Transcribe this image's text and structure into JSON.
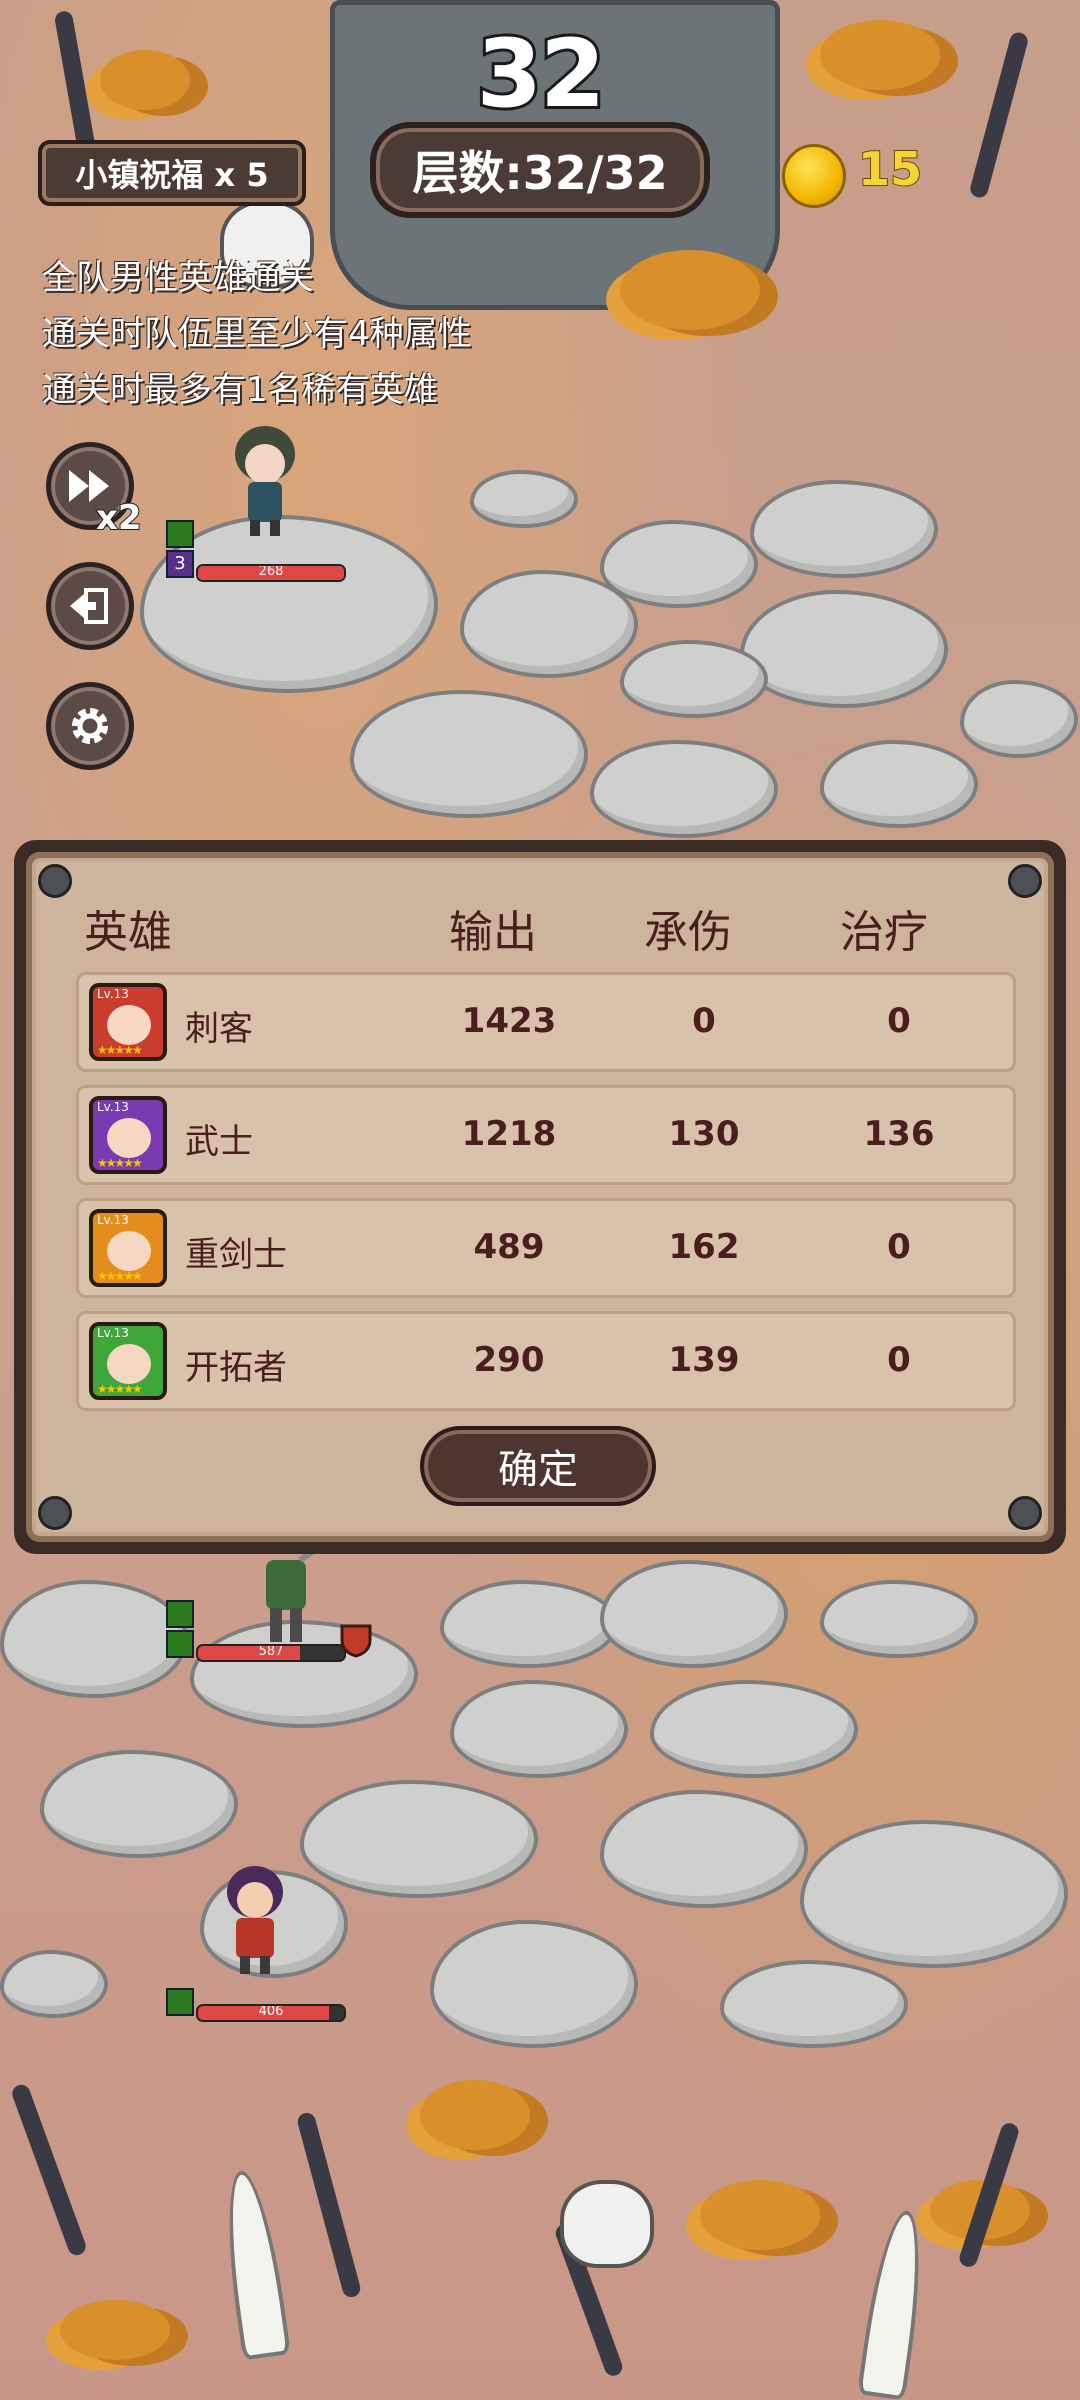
{
  "hud": {
    "floor_number": "32",
    "floor_label": "层数:32/32",
    "blessing": "小镇祝福 x 5",
    "coins": "15"
  },
  "missions": [
    "全队男性英雄通关",
    "通关时队伍里至少有4种属性",
    "通关时最多有1名稀有英雄"
  ],
  "controls": {
    "speed_multiplier": "x2",
    "fast_forward_icon": "fast-forward-icon",
    "exit_icon": "exit-icon",
    "settings_icon": "gear-icon"
  },
  "field_units": [
    {
      "hp": "268",
      "skill_level": "3"
    },
    {
      "hp": "587",
      "hp_fraction": 0.7
    },
    {
      "hp": "406",
      "hp_fraction": 0.9
    }
  ],
  "stats_panel": {
    "headers": {
      "hero": "英雄",
      "damage": "输出",
      "tank": "承伤",
      "heal": "治疗"
    },
    "rows": [
      {
        "name": "刺客",
        "level": "Lv.13",
        "stars": "★★★★★",
        "damage": "1423",
        "tank": "0",
        "heal": "0",
        "frame_color": "#c93d2f"
      },
      {
        "name": "武士",
        "level": "Lv.13",
        "stars": "★★★★★",
        "damage": "1218",
        "tank": "130",
        "heal": "136",
        "frame_color": "#7a3ab0"
      },
      {
        "name": "重剑士",
        "level": "Lv.13",
        "stars": "★★★★★",
        "damage": "489",
        "tank": "162",
        "heal": "0",
        "frame_color": "#e28d1e"
      },
      {
        "name": "开拓者",
        "level": "Lv.13",
        "stars": "★★★★★",
        "damage": "290",
        "tank": "139",
        "heal": "0",
        "frame_color": "#3fa63a"
      }
    ],
    "confirm_label": "确定"
  }
}
